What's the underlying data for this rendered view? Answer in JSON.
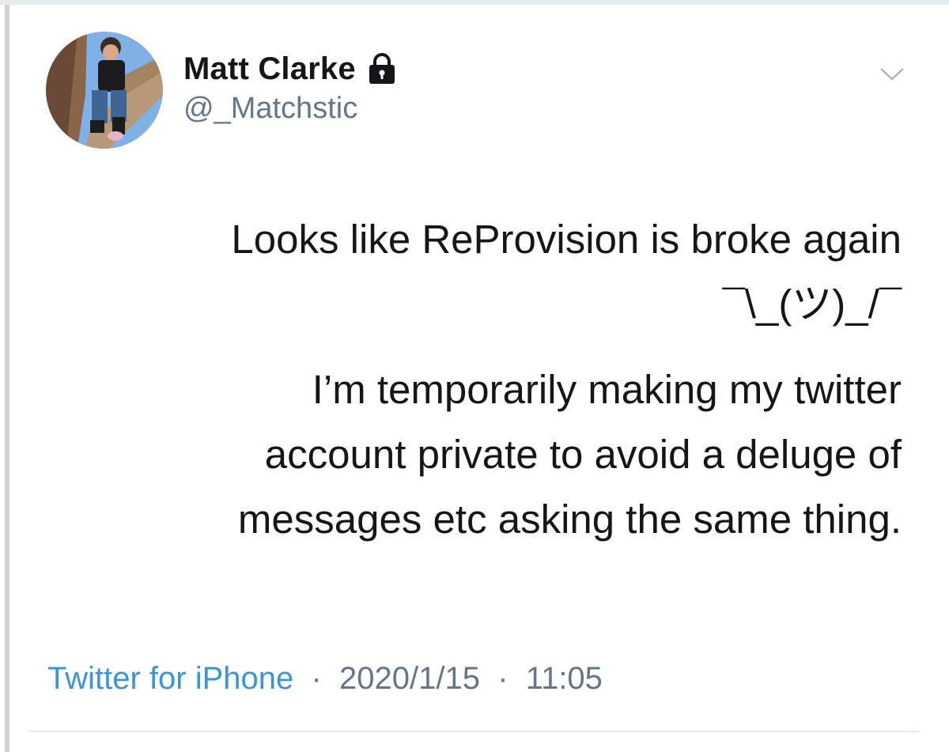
{
  "tweet": {
    "author": {
      "display_name": "Matt Clarke",
      "handle": "@_Matchstic",
      "protected": true
    },
    "text_lines": [
      "Looks like ReProvision is broke again",
      "¯\\_(ツ)_/¯",
      "I’m temporarily making my twitter",
      "account private to avoid a deluge of",
      "messages etc asking the same thing."
    ],
    "source": "Twitter for iPhone",
    "separator": "·",
    "date": "2020/1/15",
    "time": "11:05"
  },
  "colors": {
    "text": "#14171a",
    "muted": "#657786",
    "link": "#3b94d9",
    "divider": "#e6ecf0"
  },
  "icons": {
    "lock": "lock-icon",
    "chevron": "chevron-down-icon"
  }
}
